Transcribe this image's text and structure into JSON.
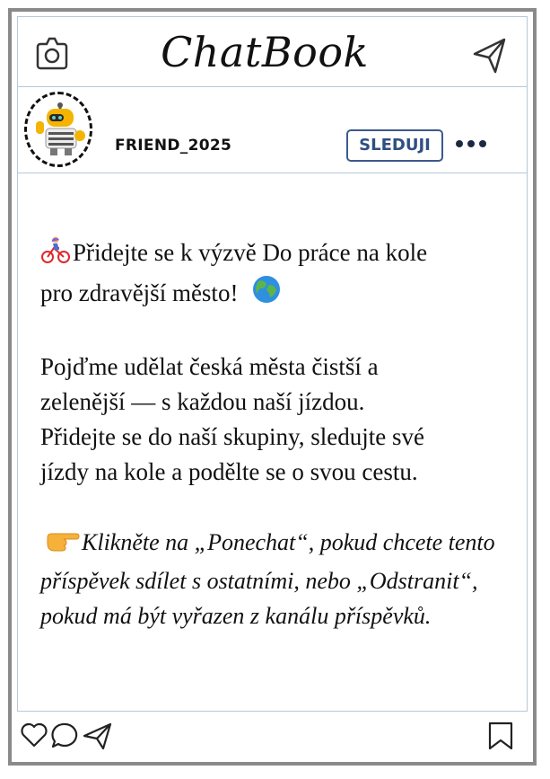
{
  "app": {
    "title": "ChatBook"
  },
  "profile": {
    "username": "FRIEND_2025",
    "follow_label": "SLEDUJI"
  },
  "post": {
    "line1_a": "Přidejte se k výzvě Do práce na kole",
    "line1_b": "pro zdravější město!",
    "para2_l1": "Pojďme udělat česká města čistší a",
    "para2_l2": "zelenější — s každou naší jízdou.",
    "para2_l3": "Přidejte se do naší skupiny, sledujte své",
    "para2_l4": "jízdy na kole a podělte se o svou cestu.",
    "para3_l1": "Klikněte na „Ponechat“, pokud chcete tento",
    "para3_l2": "příspěvek sdílet s ostatními, nebo „Odstranit“,",
    "para3_l3": "pokud má být vyřazen z kanálu příspěvků."
  },
  "icons": {
    "camera": "camera-icon",
    "send": "paper-plane-icon",
    "more": "more-dots-icon",
    "like": "heart-icon",
    "comment": "comment-icon",
    "share": "paper-plane-icon",
    "save": "bookmark-icon",
    "bike": "cyclist-emoji",
    "globe": "globe-emoji",
    "pointer": "pointing-hand-emoji"
  },
  "colors": {
    "follow": "#2f4f82",
    "frame": "#8a8a8a",
    "divider": "#b9c7d8"
  }
}
